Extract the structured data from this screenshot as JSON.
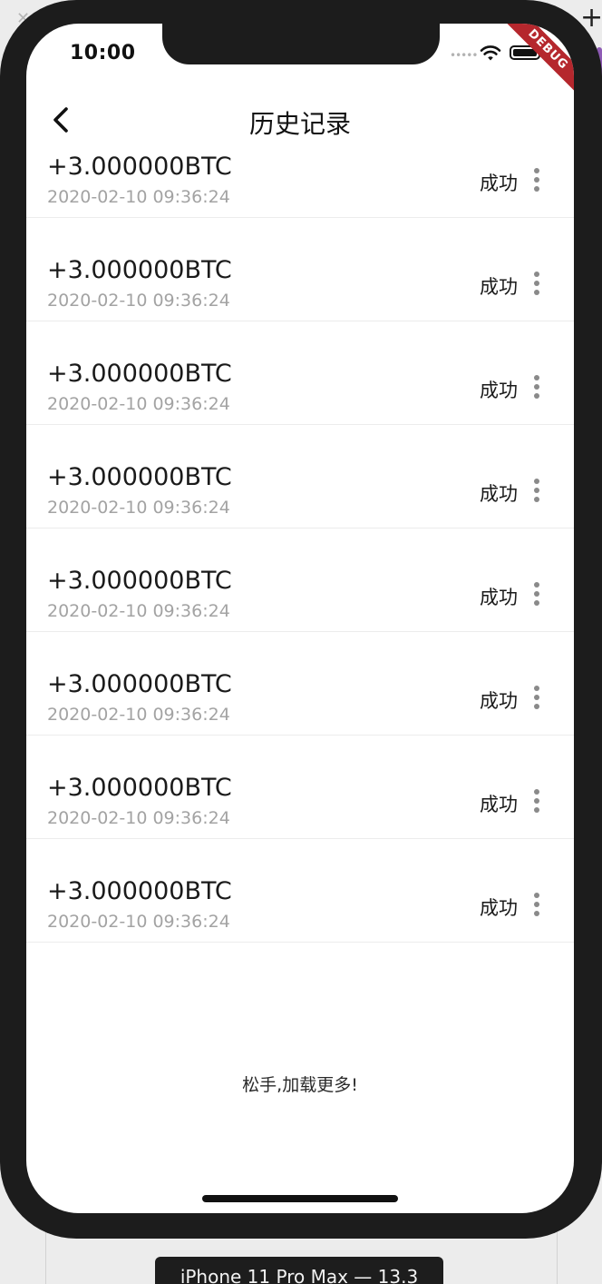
{
  "status_bar": {
    "time": "10:00",
    "signal_dots": "•••••"
  },
  "debug_banner": "DEBUG",
  "app_bar": {
    "title": "历史记录"
  },
  "records": [
    {
      "amount": "+3.000000BTC",
      "time": "2020-02-10 09:36:24",
      "status": "成功"
    },
    {
      "amount": "+3.000000BTC",
      "time": "2020-02-10 09:36:24",
      "status": "成功"
    },
    {
      "amount": "+3.000000BTC",
      "time": "2020-02-10 09:36:24",
      "status": "成功"
    },
    {
      "amount": "+3.000000BTC",
      "time": "2020-02-10 09:36:24",
      "status": "成功"
    },
    {
      "amount": "+3.000000BTC",
      "time": "2020-02-10 09:36:24",
      "status": "成功"
    },
    {
      "amount": "+3.000000BTC",
      "time": "2020-02-10 09:36:24",
      "status": "成功"
    },
    {
      "amount": "+3.000000BTC",
      "time": "2020-02-10 09:36:24",
      "status": "成功"
    },
    {
      "amount": "+3.000000BTC",
      "time": "2020-02-10 09:36:24",
      "status": "成功"
    }
  ],
  "load_more_text": "松手,加载更多!",
  "simulator_label": "iPhone 11 Pro Max — 13.3",
  "icons": {
    "back": "chevron-left-icon",
    "more": "more-vertical-icon",
    "wifi": "wifi-icon",
    "battery": "battery-icon"
  },
  "colors": {
    "debug_banner": "#b5272d",
    "secondary_text": "#a3a3a3",
    "primary_text": "#1a1a1a"
  }
}
